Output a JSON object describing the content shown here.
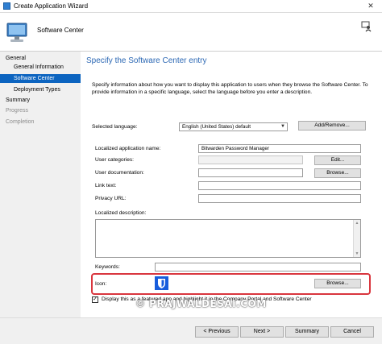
{
  "window": {
    "title": "Create Application Wizard"
  },
  "header": {
    "title": "Software Center"
  },
  "sidebar": {
    "items": [
      {
        "label": "General"
      },
      {
        "label": "General Information"
      },
      {
        "label": "Software Center"
      },
      {
        "label": "Deployment Types"
      },
      {
        "label": "Summary"
      },
      {
        "label": "Progress"
      },
      {
        "label": "Completion"
      }
    ]
  },
  "main": {
    "page_title": "Specify the Software Center entry",
    "description": "Specify information about how you want to display this application to users when they browse the Software Center. To provide information in a specific language, select the language before you enter a description.",
    "selected_language_label": "Selected language:",
    "selected_language_value": "English (United States) default",
    "add_remove_label": "Add/Remove...",
    "localized_name_label": "Localized application name:",
    "localized_name_value": "Bitwarden Password Manager",
    "user_categories_label": "User categories:",
    "user_categories_value": "",
    "edit_label": "Edit...",
    "user_documentation_label": "User documentation:",
    "user_documentation_value": "",
    "browse_label": "Browse...",
    "link_text_label": "Link text:",
    "link_text_value": "",
    "privacy_url_label": "Privacy URL:",
    "privacy_url_value": "",
    "localized_description_label": "Localized description:",
    "keywords_label": "Keywords:",
    "keywords_value": "",
    "icon_label": "Icon:",
    "icon_browse_label": "Browse...",
    "featured_label": "Display this as a featured app and highlight it in the Company Portal and Software Center",
    "featured_checked": true,
    "watermark": "© PRAJWALDESAI.COM"
  },
  "footer": {
    "previous_label": "< Previous",
    "next_label": "Next >",
    "summary_label": "Summary",
    "cancel_label": "Cancel"
  },
  "colors": {
    "accent": "#0c64c0",
    "page_title": "#2c68b4",
    "highlight": "#d9363e",
    "bitwarden": "#175ddc"
  }
}
